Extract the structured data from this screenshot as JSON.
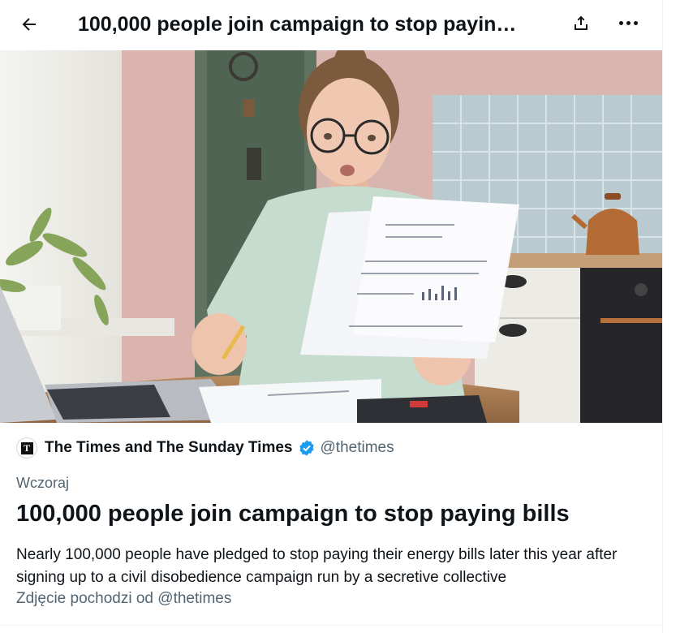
{
  "header": {
    "title": "100,000 people join campaign to stop payin…"
  },
  "article": {
    "source_name": "The Times and The Sunday Times",
    "source_handle": "@thetimes",
    "date": "Wczoraj",
    "title": "100,000 people join campaign to stop paying bills",
    "description": "Nearly 100,000 people have pledged to stop paying their energy bills later this year after signing up to a civil disobedience campaign run by a secretive collective",
    "photo_credit": "Zdjęcie pochodzi od @thetimes"
  },
  "icons": {
    "back": "arrow-left-icon",
    "share": "share-icon",
    "more": "more-horizontal-icon",
    "verified": "verified-badge-icon",
    "source_logo": "times-logo-icon"
  },
  "colors": {
    "text": "#0f1419",
    "secondary_text": "#536471",
    "verified": "#1d9bf0"
  }
}
